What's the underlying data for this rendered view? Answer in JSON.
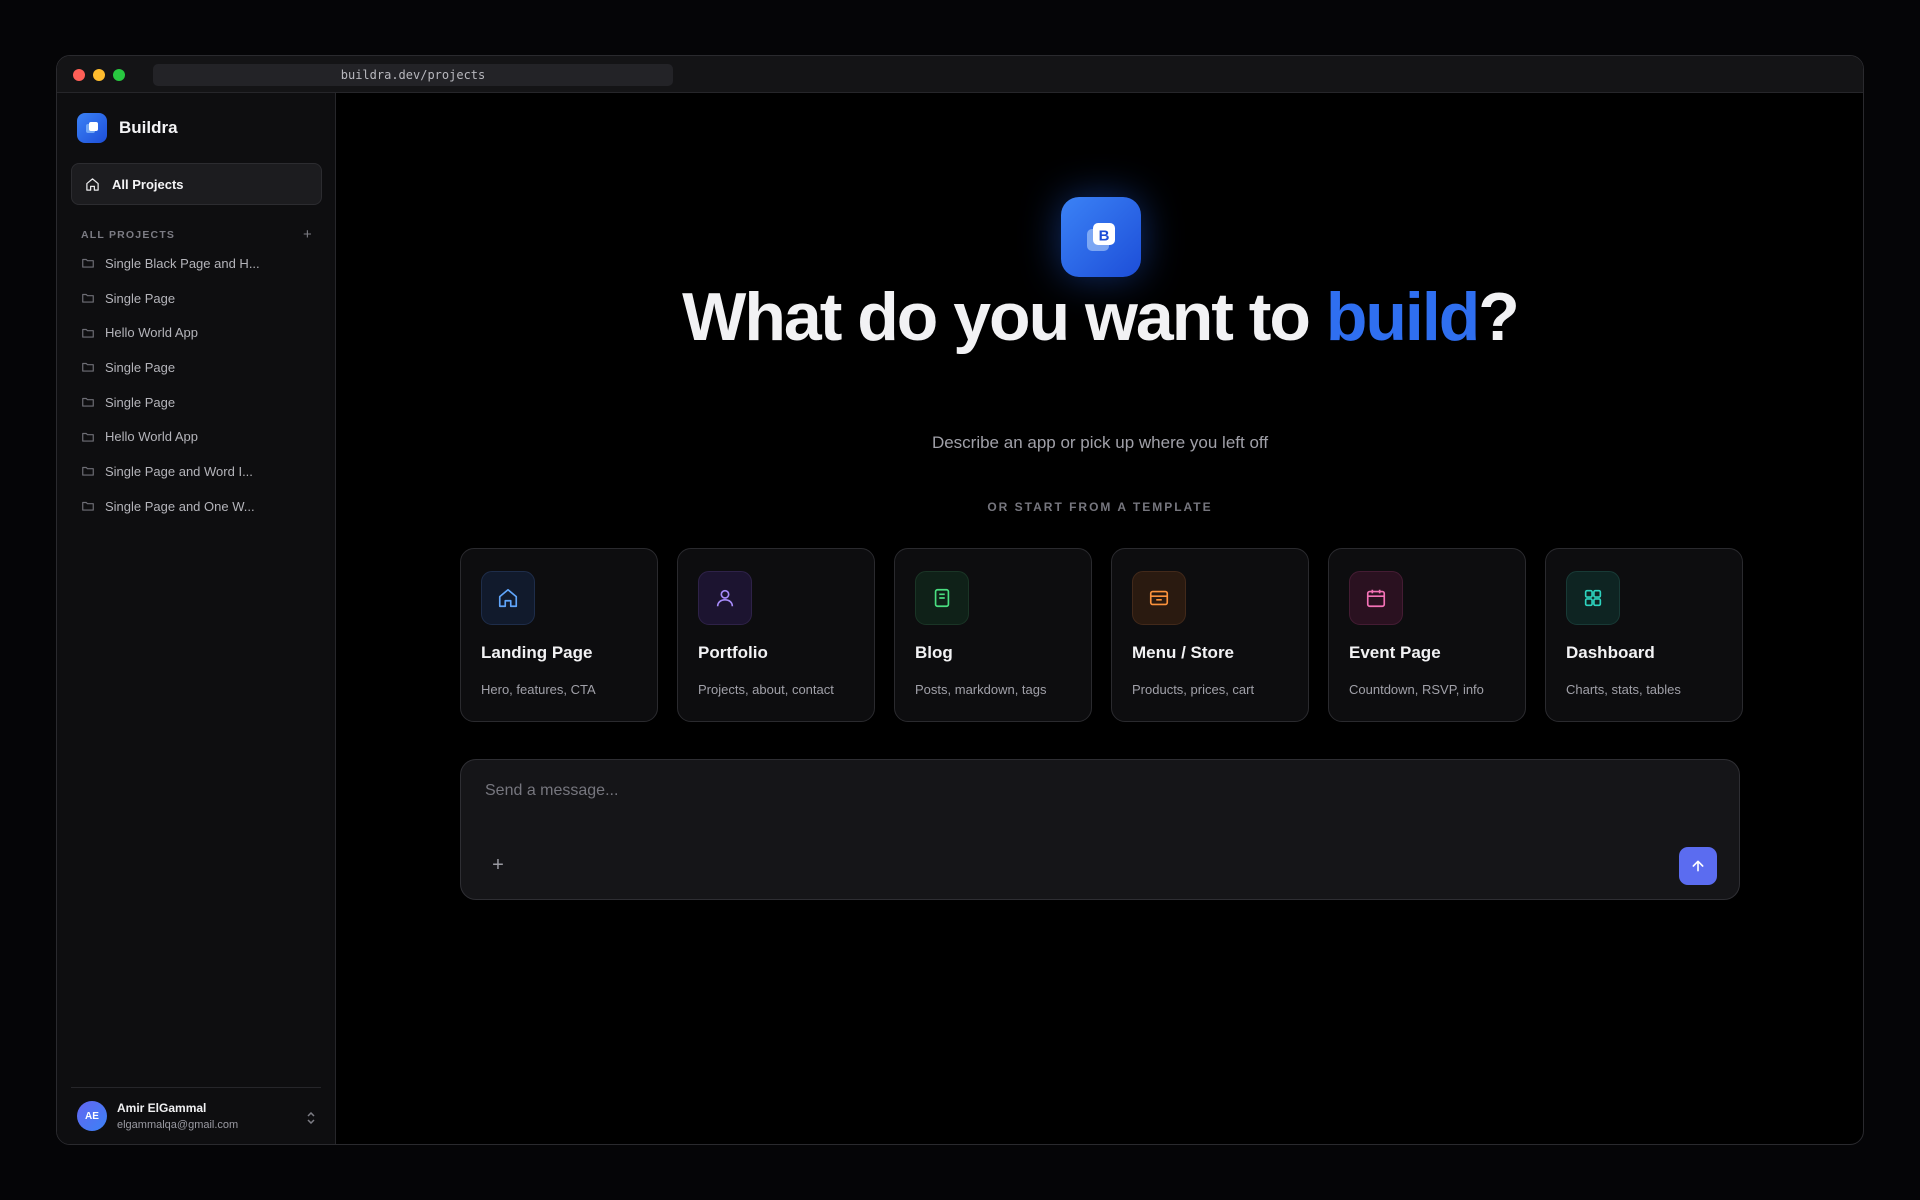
{
  "browser": {
    "url": "buildra.dev/projects"
  },
  "sidebar": {
    "brand": "Buildra",
    "nav_all": "All Projects",
    "section_title": "ALL PROJECTS",
    "section_add": "+",
    "projects": [
      "Single Black Page and H...",
      "Single Page",
      "Hello World App",
      "Single Page",
      "Single Page",
      "Hello World App",
      "Single Page and Word I...",
      "Single Page and One W..."
    ],
    "user": {
      "initials": "AE",
      "name": "Amir ElGammal",
      "email": "elgammalqa@gmail.com"
    }
  },
  "hero": {
    "logo_letter": "B",
    "title_before": "What do you want to ",
    "title_accent": "build",
    "title_after": "?",
    "subtitle": "Describe an app or pick up where you left off",
    "template_label": "OR START FROM A TEMPLATE"
  },
  "templates": [
    {
      "title": "Landing Page",
      "desc": "Hero, features, CTA",
      "icon": "home-icon",
      "color": "#60a5fa"
    },
    {
      "title": "Portfolio",
      "desc": "Projects, about, contact",
      "icon": "user-icon",
      "color": "#a78bfa"
    },
    {
      "title": "Blog",
      "desc": "Posts, markdown, tags",
      "icon": "book-icon",
      "color": "#4ade80"
    },
    {
      "title": "Menu / Store",
      "desc": "Products, prices, cart",
      "icon": "store-icon",
      "color": "#fb923c"
    },
    {
      "title": "Event Page",
      "desc": "Countdown, RSVP, info",
      "icon": "calendar-icon",
      "color": "#f472b6"
    },
    {
      "title": "Dashboard",
      "desc": "Charts, stats, tables",
      "icon": "grid-icon",
      "color": "#2dd4bf"
    }
  ],
  "composer": {
    "placeholder": "Send a message...",
    "attach_label": "+"
  },
  "colors": {
    "accent": "#2f6ff0",
    "send": "#5b6cf0",
    "background": "#000000"
  }
}
